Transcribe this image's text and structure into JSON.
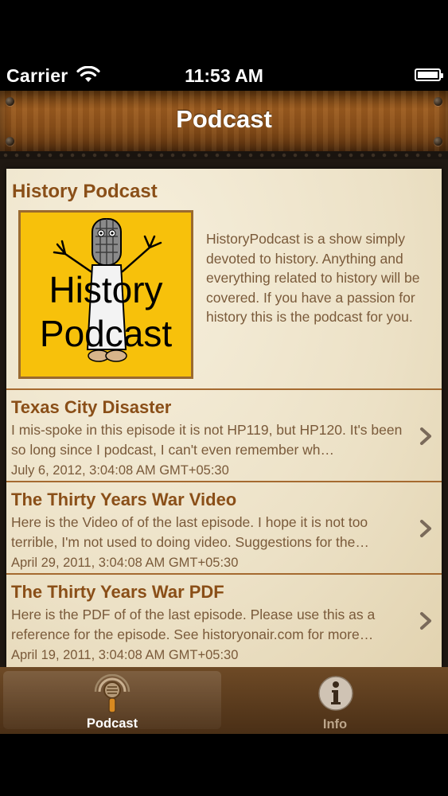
{
  "status_bar": {
    "carrier": "Carrier",
    "time": "11:53 AM"
  },
  "nav": {
    "title": "Podcast"
  },
  "podcast": {
    "name": "History Podcast",
    "artwork_lines": [
      "History",
      "Podcast"
    ],
    "description": "HistoryPodcast is a show simply devoted to history. Anything and everything related to history will be covered. If you have a passion for history this is the podcast for you."
  },
  "episodes": [
    {
      "title": "Texas City Disaster",
      "summary": "I mis-spoke in this episode it is not HP119, but HP120. It's been so long since I podcast, I can't even remember wh…",
      "date": "July 6, 2012, 3:04:08 AM GMT+05:30"
    },
    {
      "title": "The Thirty Years War Video",
      "summary": "Here is the Video of of the last episode. I hope it is not too terrible, I'm not used to doing video. Suggestions for the…",
      "date": "April 29, 2011, 3:04:08 AM GMT+05:30"
    },
    {
      "title": "The Thirty Years War PDF",
      "summary": "Here is the PDF of of the last episode. Please use this as a reference for the episode. See historyonair.com for more…",
      "date": "April 19, 2011, 3:04:08 AM GMT+05:30"
    }
  ],
  "tabs": [
    {
      "label": "Podcast",
      "icon": "microphone-icon",
      "selected": true
    },
    {
      "label": "Info",
      "icon": "info-icon",
      "selected": false
    }
  ],
  "colors": {
    "accent": "#8a4f18",
    "body_text": "#7a5a3a",
    "artwork_bg": "#f7c10b"
  }
}
